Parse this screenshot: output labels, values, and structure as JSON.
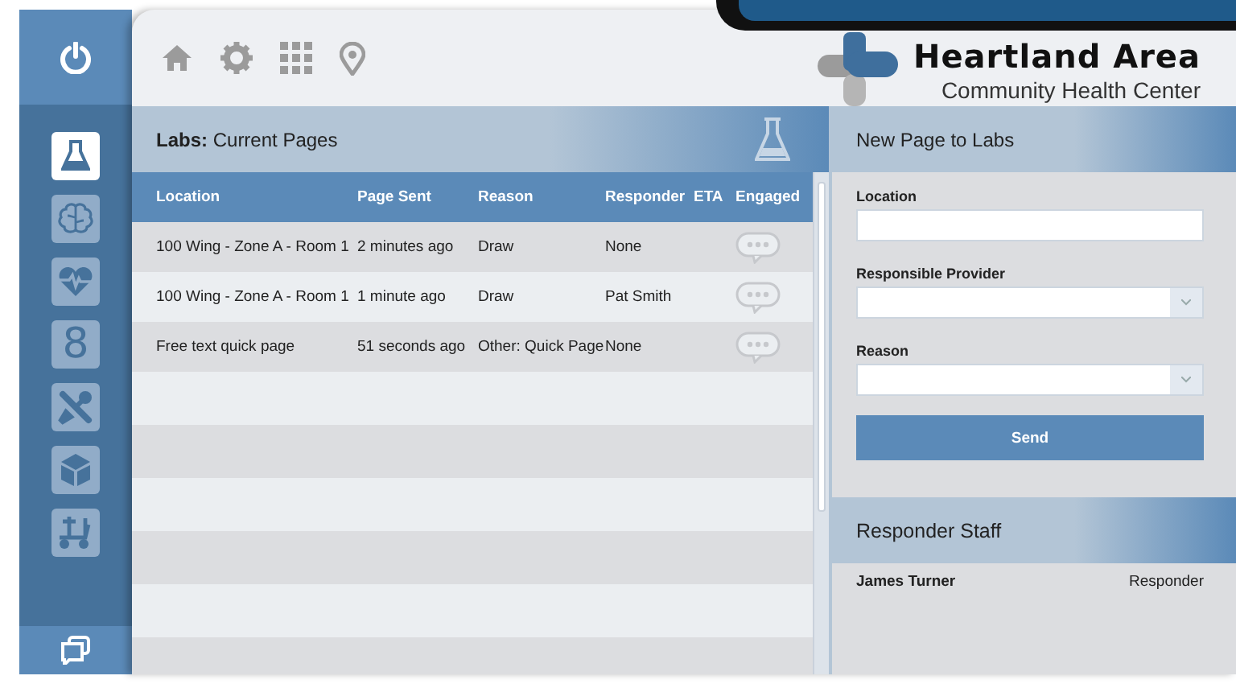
{
  "sidebar": {
    "items": [
      {
        "selected": true
      },
      {
        "selected": false
      },
      {
        "selected": false
      },
      {
        "label": "8",
        "selected": false
      },
      {
        "selected": false
      },
      {
        "selected": false
      },
      {
        "selected": false
      }
    ]
  },
  "logo": {
    "name": "Heartland Area",
    "subtitle": "Community Health Center"
  },
  "labs_panel": {
    "title": "**Labs:** Current Pages",
    "table": {
      "columns": [
        "Location",
        "Page Sent",
        "Reason",
        "Responder",
        "ETA",
        "Engaged"
      ],
      "rows": [
        {
          "location": "100 Wing - Zone A - Room 1",
          "page_sent": "2 minutes ago",
          "reason": "Draw",
          "responder": "None"
        },
        {
          "location": "100 Wing - Zone A - Room 1",
          "page_sent": "1 minute ago",
          "reason": "Draw",
          "responder": "Pat Smith"
        },
        {
          "location": "Free text quick page",
          "page_sent": "51 seconds ago",
          "reason": "Other: Quick Page",
          "responder": "None"
        }
      ]
    }
  },
  "new_page_form": {
    "title": "New Page to Labs",
    "fields": [
      {
        "label": "Location",
        "kind": "text"
      },
      {
        "label": "Responsible Provider",
        "kind": "select"
      },
      {
        "label": "Reason",
        "kind": "select"
      }
    ],
    "button": "Send"
  },
  "responder_staff": {
    "title": "Responder Staff",
    "rows": [
      {
        "name": "James Turner",
        "role": "Responder"
      }
    ]
  }
}
